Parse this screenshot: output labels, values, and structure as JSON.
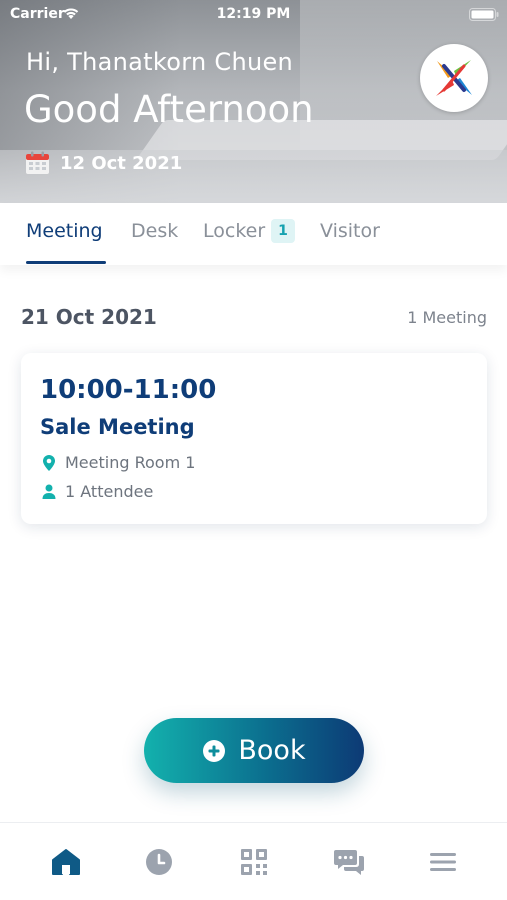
{
  "status_bar": {
    "carrier": "Carrier",
    "time": "12:19 PM"
  },
  "header": {
    "greeting": "Hi, Thanatkorn Chuen",
    "daypart": "Good Afternoon",
    "date": "12 Oct 2021",
    "calendar_icon": "calendar-icon",
    "logo_icon": "company-logo"
  },
  "tabs": [
    {
      "label": "Meeting",
      "active": true
    },
    {
      "label": "Desk",
      "active": false
    },
    {
      "label": "Locker",
      "active": false,
      "badge": "1"
    },
    {
      "label": "Visitor",
      "active": false
    }
  ],
  "schedule": {
    "date": "21 Oct 2021",
    "count_label": "1 Meeting",
    "meetings": [
      {
        "time": "10:00-11:00",
        "title": "Sale Meeting",
        "room": "Meeting Room 1",
        "attendees": "1 Attendee"
      }
    ]
  },
  "book_button": {
    "label": "Book",
    "icon": "plus-circle-icon"
  },
  "bottom_nav": [
    {
      "icon": "home-icon",
      "active": true
    },
    {
      "icon": "clock-icon",
      "active": false
    },
    {
      "icon": "qr-code-icon",
      "active": false
    },
    {
      "icon": "chat-icon",
      "active": false
    },
    {
      "icon": "menu-icon",
      "active": false
    }
  ],
  "colors": {
    "primary": "#0f3d78",
    "accent": "#13b1ad",
    "badge_bg": "#dff4f5",
    "inactive": "#8a9099"
  }
}
